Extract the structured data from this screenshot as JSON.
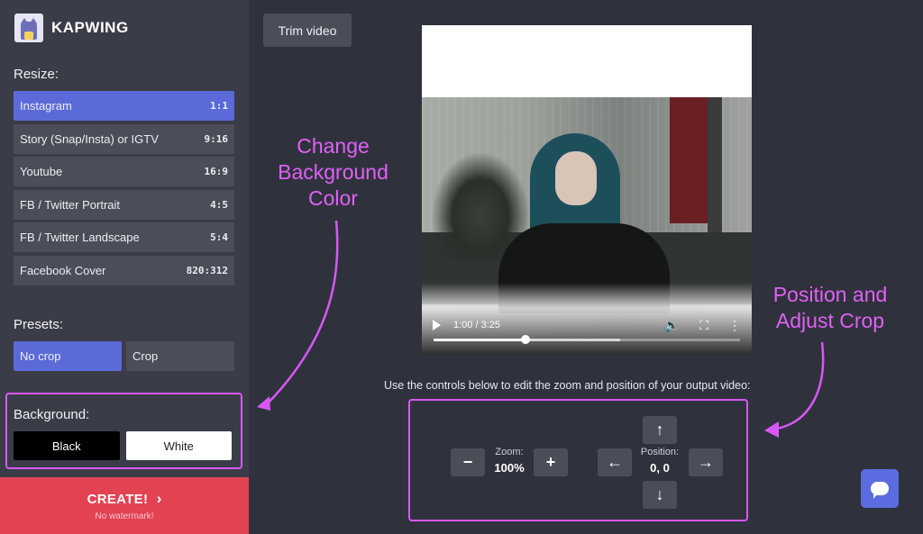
{
  "app": {
    "name": "KAPWING"
  },
  "sidebar": {
    "resize_label": "Resize:",
    "resize_items": [
      {
        "label": "Instagram",
        "ratio": "1:1",
        "active": true
      },
      {
        "label": "Story (Snap/Insta) or IGTV",
        "ratio": "9:16",
        "active": false
      },
      {
        "label": "Youtube",
        "ratio": "16:9",
        "active": false
      },
      {
        "label": "FB / Twitter Portrait",
        "ratio": "4:5",
        "active": false
      },
      {
        "label": "FB / Twitter Landscape",
        "ratio": "5:4",
        "active": false
      },
      {
        "label": "Facebook Cover",
        "ratio": "820:312",
        "active": false
      }
    ],
    "presets_label": "Presets:",
    "presets": [
      {
        "label": "No crop",
        "active": true
      },
      {
        "label": "Crop",
        "active": false
      }
    ],
    "background_label": "Background:",
    "background_options": [
      {
        "label": "Black"
      },
      {
        "label": "White"
      }
    ],
    "create": {
      "label": "CREATE!",
      "sublabel": "No watermark!"
    }
  },
  "toolbar": {
    "trim_label": "Trim video"
  },
  "player": {
    "time": "1:00 / 3:25",
    "progress": 0.3,
    "buffered": 0.61
  },
  "editor": {
    "hint": "Use the controls below to edit the zoom and position of your output video:",
    "zoom_label": "Zoom:",
    "zoom_value": "100%",
    "position_label": "Position:",
    "position_value": "0, 0"
  },
  "annotations": {
    "background": "Change Background Color",
    "crop": "Position and Adjust Crop"
  },
  "colors": {
    "accent": "#5b6ad8",
    "create": "#e34253",
    "annotation": "#d957f5"
  }
}
